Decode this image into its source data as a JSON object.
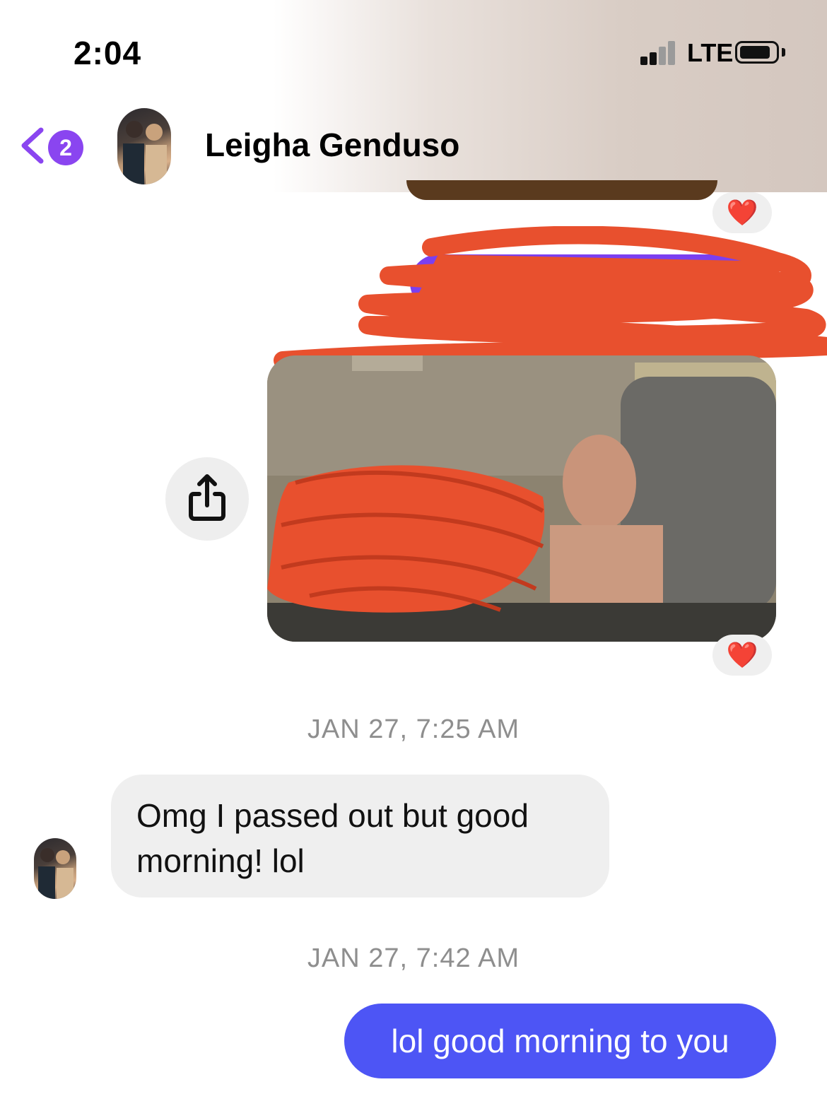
{
  "status_bar": {
    "time": "2:04",
    "network": "LTE"
  },
  "header": {
    "unread_count": "2",
    "contact_name": "Leigha Genduso"
  },
  "messages": {
    "timestamp_1": "JAN 27, 7:25 AM",
    "incoming_text": "Omg I passed out but good morning! lol",
    "timestamp_2": "JAN 27, 7:42 AM",
    "outgoing_text": "lol good morning to you",
    "reaction": "❤️"
  },
  "colors": {
    "accent": "#8a45f0",
    "outgoing_bubble": "#4d55f5",
    "redaction": "#e8502e"
  },
  "icons": [
    "chevron-left-icon",
    "share-icon",
    "heart-icon",
    "signal-icon",
    "battery-icon"
  ]
}
